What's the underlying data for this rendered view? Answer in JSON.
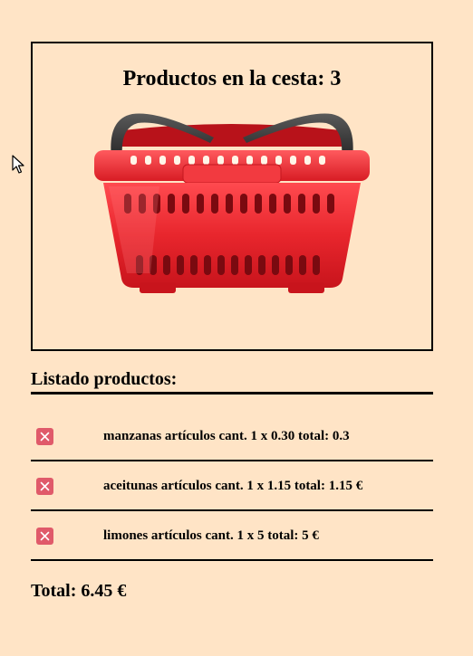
{
  "basket": {
    "title": "Productos en la cesta: 3",
    "image_icon": "shopping-basket-icon"
  },
  "list": {
    "heading": "Listado productos:",
    "remove_icon": "close-icon",
    "items": [
      {
        "text": "manzanas artículos cant. 1 x 0.30 total: 0.3"
      },
      {
        "text": "aceitunas artículos cant. 1 x 1.15 total: 1.15 €"
      },
      {
        "text": "limones artículos cant. 1 x 5 total: 5 €"
      }
    ]
  },
  "total": "Total: 6.45 €",
  "colors": {
    "background": "#ffe4c6",
    "remove_button": "#e05a6a",
    "basket_red": "#e8282e",
    "basket_handle": "#2b2b2b"
  },
  "cursor_icon": "mouse-pointer-icon"
}
